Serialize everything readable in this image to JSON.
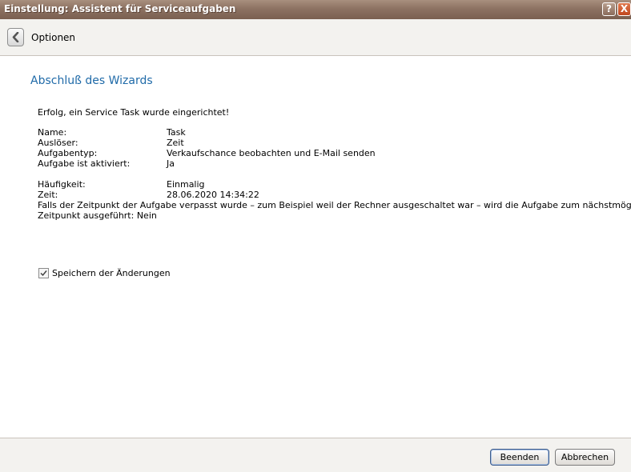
{
  "window": {
    "title": "Einstellung: Assistent für Serviceaufgaben",
    "help_label": "?",
    "close_label": "X"
  },
  "toolbar": {
    "label": "Optionen"
  },
  "main": {
    "heading": "Abschluß des Wizards",
    "success_message": "Erfolg, ein Service Task wurde eingerichtet!",
    "details": [
      {
        "label": "Name:",
        "value": "Task"
      },
      {
        "label": "Auslöser:",
        "value": "Zeit"
      },
      {
        "label": "Aufgabentyp:",
        "value": "Verkaufschance beobachten und E-Mail senden"
      },
      {
        "label": "Aufgabe ist aktiviert:",
        "value": "Ja"
      }
    ],
    "schedule": [
      {
        "label": "Häufigkeit:",
        "value": "Einmalig"
      },
      {
        "label": "Zeit:",
        "value": "28.06.2020 14:34:22"
      }
    ],
    "missed_note_line1": "Falls der Zeitpunkt der Aufgabe verpasst wurde – zum Beispiel weil der Rechner ausgeschaltet war – wird die Aufgabe zum nächstmöglichen",
    "missed_note_line2": "Zeitpunkt ausgeführt: Nein",
    "save_checkbox": {
      "label": "Speichern der Änderungen",
      "checked": true
    }
  },
  "footer": {
    "finish_label": "Beenden",
    "cancel_label": "Abbrechen"
  }
}
